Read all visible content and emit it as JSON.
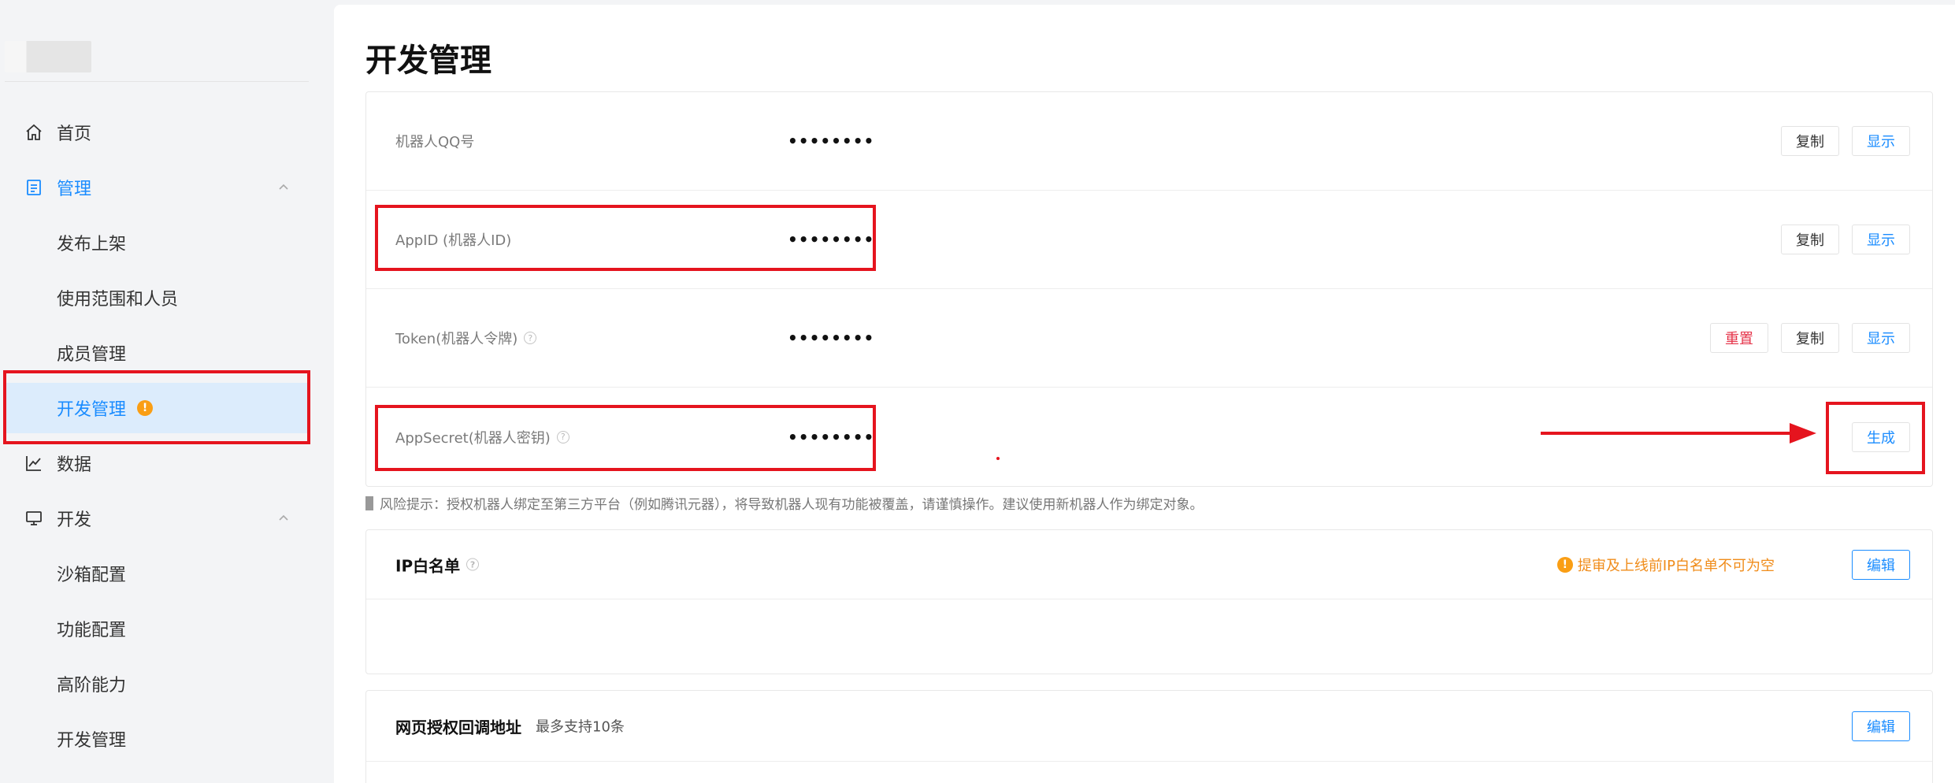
{
  "sidebar": {
    "items": [
      {
        "label": "首页",
        "icon": "home-icon"
      },
      {
        "label": "管理",
        "icon": "document-icon"
      },
      {
        "label": "发布上架"
      },
      {
        "label": "使用范围和人员"
      },
      {
        "label": "成员管理"
      },
      {
        "label": "开发管理",
        "badge": "!"
      },
      {
        "label": "数据",
        "icon": "chart-icon"
      },
      {
        "label": "开发",
        "icon": "monitor-icon"
      },
      {
        "label": "沙箱配置"
      },
      {
        "label": "功能配置"
      },
      {
        "label": "高阶能力"
      },
      {
        "label": "开发管理"
      }
    ]
  },
  "main": {
    "title": "开发管理",
    "credentials": [
      {
        "label": "机器人QQ号",
        "value": "••••••••",
        "copy": "复制",
        "show": "显示"
      },
      {
        "label": "AppID (机器人ID)",
        "value": "••••••••",
        "copy": "复制",
        "show": "显示"
      },
      {
        "label": "Token(机器人令牌)",
        "value": "••••••••",
        "reset": "重置",
        "copy": "复制",
        "show": "显示"
      },
      {
        "label": "AppSecret(机器人密钥)",
        "value": "••••••••",
        "generate": "生成"
      }
    ],
    "risk_note": "风险提示：授权机器人绑定至第三方平台（例如腾讯元器），将导致机器人现有功能被覆盖，请谨慎操作。建议使用新机器人作为绑定对象。",
    "ip_whitelist": {
      "title": "IP白名单",
      "warning": "提审及上线前IP白名单不可为空",
      "edit": "编辑"
    },
    "web_callback": {
      "title": "网页授权回调地址",
      "subtitle": "最多支持10条",
      "edit": "编辑"
    }
  },
  "colors": {
    "accent": "#1a8cff",
    "warning": "#fa9e14",
    "danger": "#e5344a",
    "annotation": "#e5141e"
  }
}
